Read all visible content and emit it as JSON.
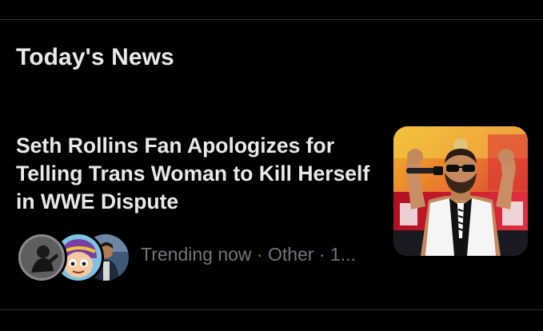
{
  "section": {
    "title": "Today's News"
  },
  "story": {
    "headline": "Seth Rollins Fan Apologizes for Telling Trans Woman to Kill Herself in WWE Dispute",
    "meta": "Trending now · Other · 1...",
    "thumbnail_icon": "wrestler-photo",
    "avatar_icons": [
      "avatar-silhouette",
      "avatar-cartoon",
      "avatar-person"
    ]
  },
  "colors": {
    "background": "#000000",
    "primary_text": "#e7e9ea",
    "secondary_text": "#71767b",
    "divider": "#2f3336"
  }
}
